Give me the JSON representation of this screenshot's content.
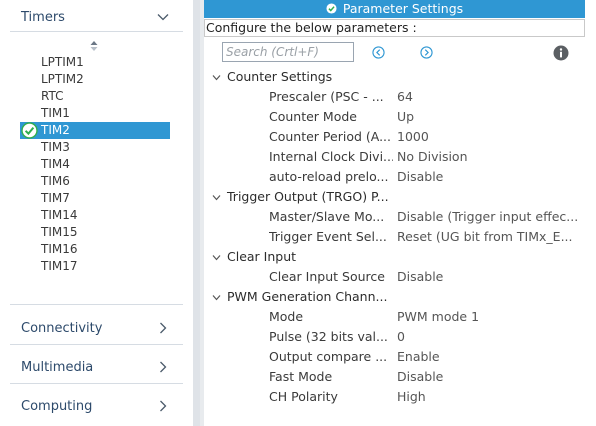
{
  "left_panel": {
    "timers_header": "Timers",
    "peripherals": [
      {
        "label": "LPTIM1"
      },
      {
        "label": "LPTIM2"
      },
      {
        "label": "RTC"
      },
      {
        "label": "TIM1"
      },
      {
        "label": "TIM2",
        "selected": true
      },
      {
        "label": "TIM3"
      },
      {
        "label": "TIM4"
      },
      {
        "label": "TIM6"
      },
      {
        "label": "TIM7"
      },
      {
        "label": "TIM14"
      },
      {
        "label": "TIM15"
      },
      {
        "label": "TIM16"
      },
      {
        "label": "TIM17"
      }
    ],
    "connectivity_header": "Connectivity",
    "multimedia_header": "Multimedia",
    "computing_header": "Computing"
  },
  "right_panel": {
    "tab_title": "Parameter Settings",
    "hint": "Configure the below parameters :",
    "search_placeholder": "Search (Crtl+F)",
    "groups": [
      {
        "label": "Counter Settings",
        "params": [
          {
            "name": "Prescaler (PSC - ...",
            "value": "64"
          },
          {
            "name": "Counter Mode",
            "value": "Up"
          },
          {
            "name": "Counter Period (A...",
            "value": "1000"
          },
          {
            "name": "Internal Clock Divi...",
            "value": "No Division"
          },
          {
            "name": "auto-reload prelo...",
            "value": "Disable"
          }
        ]
      },
      {
        "label": "Trigger Output (TRGO) P...",
        "params": [
          {
            "name": "Master/Slave Mo...",
            "value": "Disable (Trigger input effec..."
          },
          {
            "name": "Trigger Event Sel...",
            "value": "Reset (UG bit from TIMx_E..."
          }
        ]
      },
      {
        "label": "Clear Input",
        "params": [
          {
            "name": "Clear Input Source",
            "value": "Disable"
          }
        ]
      },
      {
        "label": "PWM Generation Chann...",
        "params": [
          {
            "name": "Mode",
            "value": "PWM mode 1"
          },
          {
            "name": "Pulse (32 bits val...",
            "value": "0"
          },
          {
            "name": "Output compare ...",
            "value": "Enable"
          },
          {
            "name": "Fast Mode",
            "value": "Disable"
          },
          {
            "name": "CH Polarity",
            "value": "High"
          }
        ]
      }
    ]
  },
  "colors": {
    "accent": "#2f97d3",
    "category_text": "#2d4a6b",
    "check_green": "#2fae4e"
  }
}
